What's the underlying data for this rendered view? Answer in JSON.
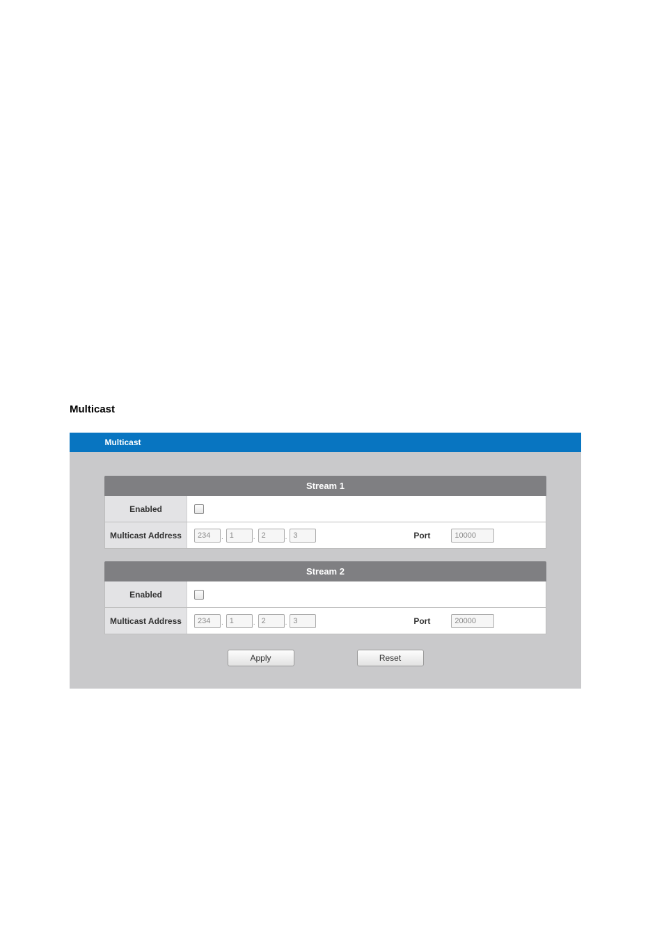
{
  "section": {
    "title": "Multicast"
  },
  "tab": {
    "label": "Multicast"
  },
  "streams": [
    {
      "header": "Stream 1",
      "enabled_label": "Enabled",
      "enabled": false,
      "address_label": "Multicast Address",
      "ip": [
        "234",
        "1",
        "2",
        "3"
      ],
      "port_label": "Port",
      "port": "10000"
    },
    {
      "header": "Stream 2",
      "enabled_label": "Enabled",
      "enabled": false,
      "address_label": "Multicast Address",
      "ip": [
        "234",
        "1",
        "2",
        "3"
      ],
      "port_label": "Port",
      "port": "20000"
    }
  ],
  "buttons": {
    "apply": "Apply",
    "reset": "Reset"
  }
}
